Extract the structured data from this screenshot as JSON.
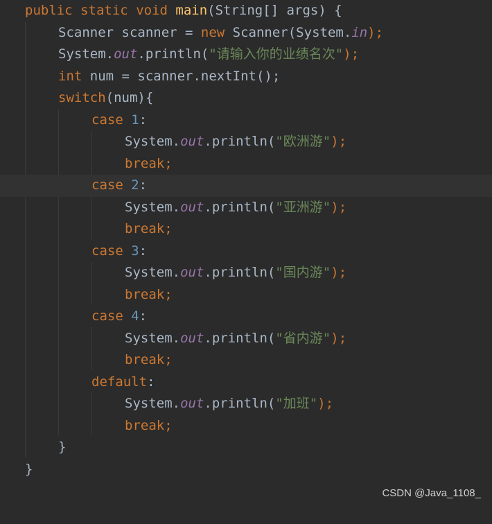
{
  "code": {
    "l1": [
      "public",
      "static",
      "void",
      "main",
      "(String[] args) {"
    ],
    "l2": [
      "Scanner scanner = ",
      "new",
      " Scanner(System.",
      "in",
      ");"
    ],
    "l3": [
      "System.",
      "out",
      ".println(",
      "\"请输入你的业绩名次\"",
      ");"
    ],
    "l4": [
      "int",
      " num = scanner.nextInt();"
    ],
    "l5": [
      "switch",
      "(num){"
    ],
    "case_kw": "case",
    "case_nums": [
      "1",
      "2",
      "3",
      "4"
    ],
    "colon": ":",
    "print_prefix": "System.",
    "out": "out",
    "println": ".println(",
    "close_paren": ");",
    "messages": [
      "\"欧洲游\"",
      "\"亚洲游\"",
      "\"国内游\"",
      "\"省内游\"",
      "\"加班\""
    ],
    "break_kw": "break;",
    "default_kw": "default",
    "close_switch": "}",
    "close_main": "}"
  },
  "watermark": "CSDN @Java_1108_",
  "colors": {
    "background": "#2b2b2b",
    "keyword": "#cc7832",
    "method": "#ffc66d",
    "field": "#9876aa",
    "string": "#6a8759",
    "number": "#6897bb",
    "text": "#a9b7c6"
  }
}
